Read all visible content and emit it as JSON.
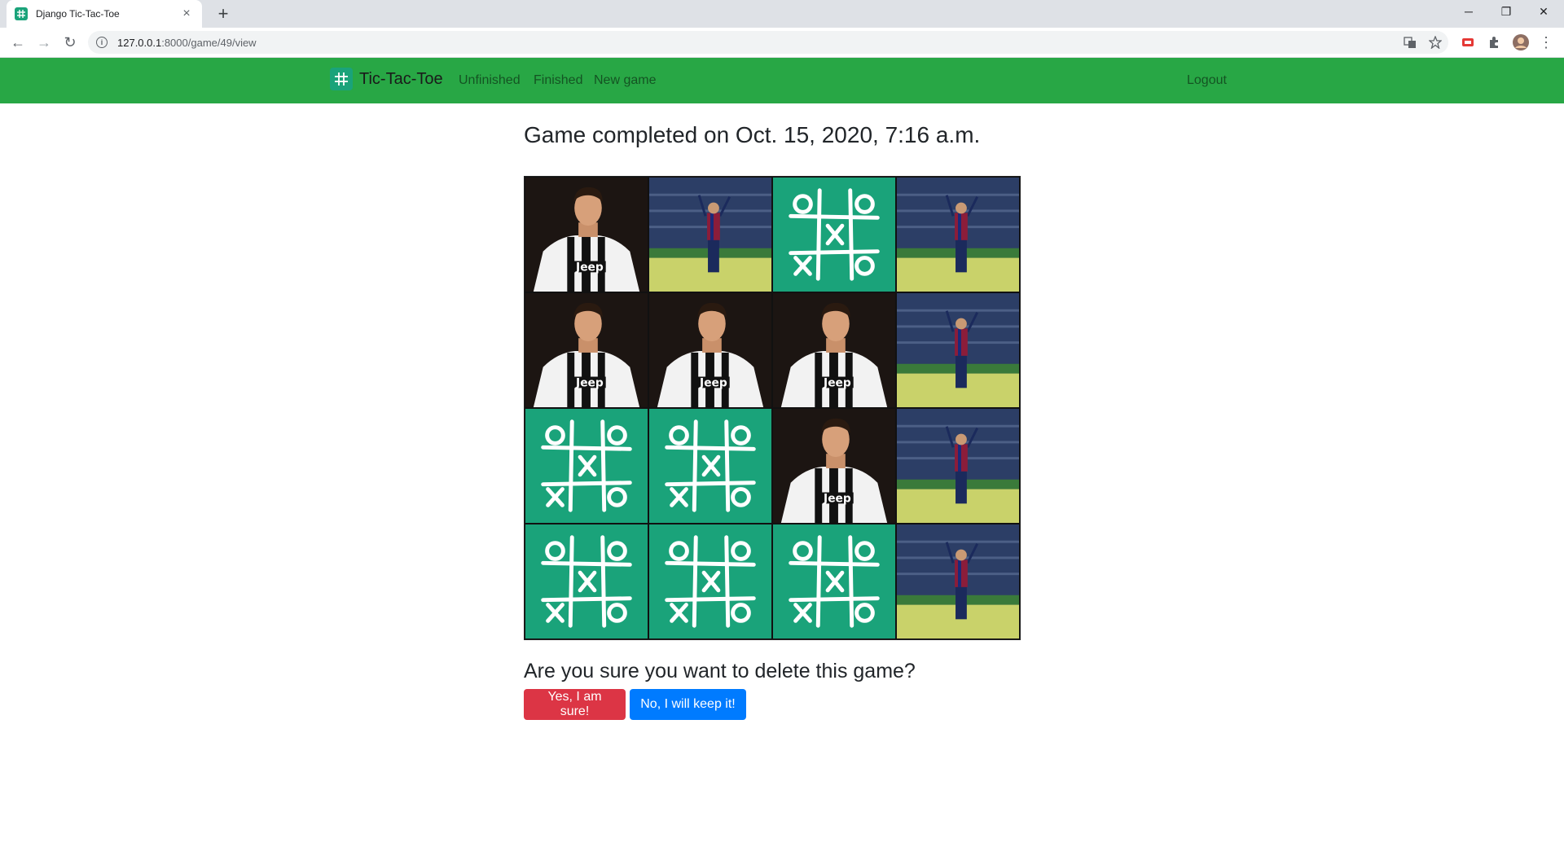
{
  "browser": {
    "tab_title": "Django Tic-Tac-Toe",
    "tab_close": "×",
    "new_tab": "+",
    "url_host": "127.0.0.1",
    "url_path": ":8000/game/49/view",
    "window_controls": {
      "minimize": "─",
      "restore": "❐",
      "close": "✕"
    },
    "nav": {
      "back": "←",
      "forward": "→",
      "reload": "↻",
      "menu": "⋮"
    }
  },
  "navbar": {
    "brand": "Tic-Tac-Toe",
    "links": [
      "Unfinished",
      "Finished",
      "New game"
    ],
    "logout": "Logout",
    "color": "#28a745"
  },
  "main": {
    "heading": "Game completed on Oct. 15, 2020, 7:16 a.m.",
    "board": [
      [
        "ronaldo",
        "messi",
        "empty",
        "messi"
      ],
      [
        "ronaldo",
        "ronaldo",
        "ronaldo",
        "messi"
      ],
      [
        "empty",
        "empty",
        "ronaldo",
        "messi"
      ],
      [
        "empty",
        "empty",
        "empty",
        "messi"
      ]
    ],
    "question": "Are you sure you want to delete this game?",
    "confirm_button": "Yes, I am sure!",
    "cancel_button": "No, I will keep it!"
  },
  "colors": {
    "empty_cell": "#1aa37a",
    "danger": "#dc3545",
    "primary": "#007bff"
  }
}
